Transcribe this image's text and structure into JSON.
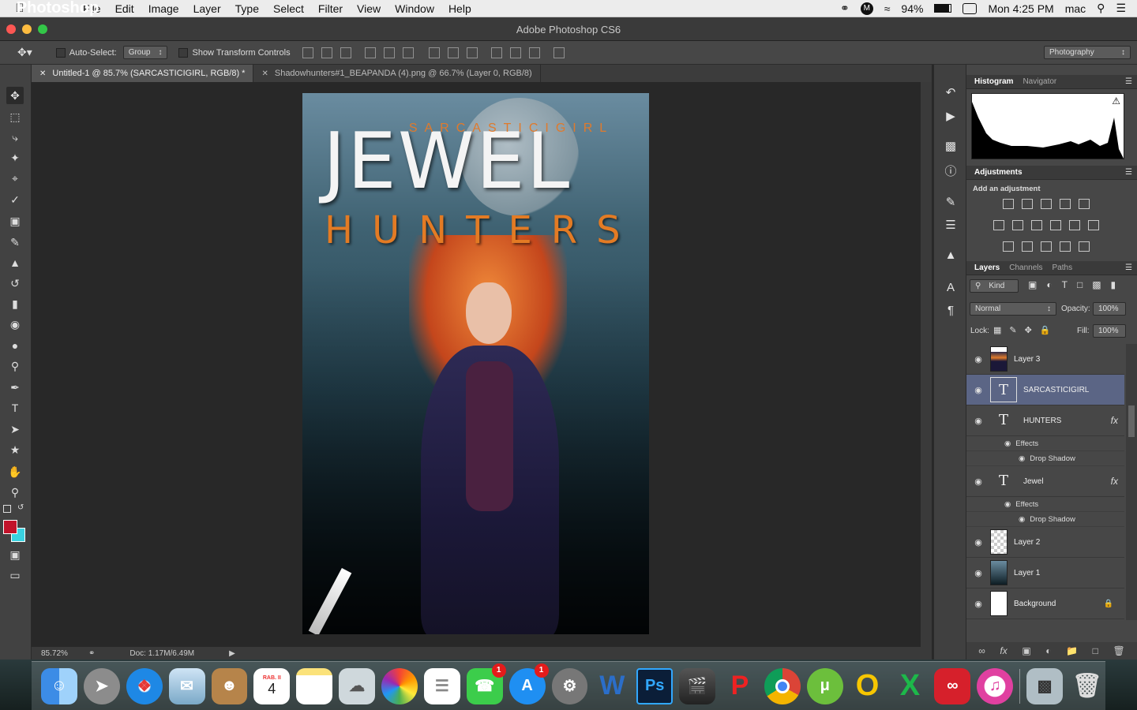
{
  "menubar": {
    "app_name": "Photoshop",
    "items": [
      "File",
      "Edit",
      "Image",
      "Layer",
      "Type",
      "Select",
      "Filter",
      "View",
      "Window",
      "Help"
    ],
    "battery": "94%",
    "datetime": "Mon 4:25 PM",
    "user": "mac"
  },
  "window": {
    "title": "Adobe Photoshop CS6"
  },
  "options": {
    "auto_select_label": "Auto-Select:",
    "auto_select_value": "Group",
    "transform_label": "Show Transform Controls",
    "workspace": "Photography"
  },
  "tabs": [
    {
      "label": "Untitled-1 @ 85.7% (SARCASTICIGIRL, RGB/8) *"
    },
    {
      "label": "Shadowhunters#1_BEAPANDA (4).png @ 66.7% (Layer 0, RGB/8)"
    }
  ],
  "cover": {
    "author": "SARCASTICIGIRL",
    "title_line1": "JEWEL",
    "title_line2": "HUNTERS"
  },
  "status": {
    "zoom": "85.72%",
    "doc": "Doc: 1.17M/6.49M"
  },
  "colors": {
    "foreground": "#c2122a",
    "background": "#3ad2e0",
    "selection": "#5b6585"
  },
  "panels": {
    "top_tabs": [
      "Histogram",
      "Navigator"
    ],
    "adjustments_title": "Adjustments",
    "adjustments_subtitle": "Add an adjustment",
    "layers_tabs": [
      "Layers",
      "Channels",
      "Paths"
    ],
    "kind": "Kind",
    "blend_mode": "Normal",
    "opacity_label": "Opacity:",
    "opacity_value": "100%",
    "lock_label": "Lock:",
    "fill_label": "Fill:",
    "fill_value": "100%"
  },
  "layers": {
    "layer3": "Layer 3",
    "sarcastic": "SARCASTICIGIRL",
    "hunters": "HUNTERS",
    "hunters_effects": "Effects",
    "hunters_shadow": "Drop Shadow",
    "jewel": "Jewel",
    "jewel_effects": "Effects",
    "jewel_shadow": "Drop Shadow",
    "layer2": "Layer 2",
    "layer1": "Layer 1",
    "background": "Background"
  },
  "dock": {
    "calendar_month": "RAB. II",
    "calendar_day": "4",
    "facetime_badge": "1",
    "appstore_badge": "1",
    "ps_label": "Ps",
    "word_label": "W"
  }
}
